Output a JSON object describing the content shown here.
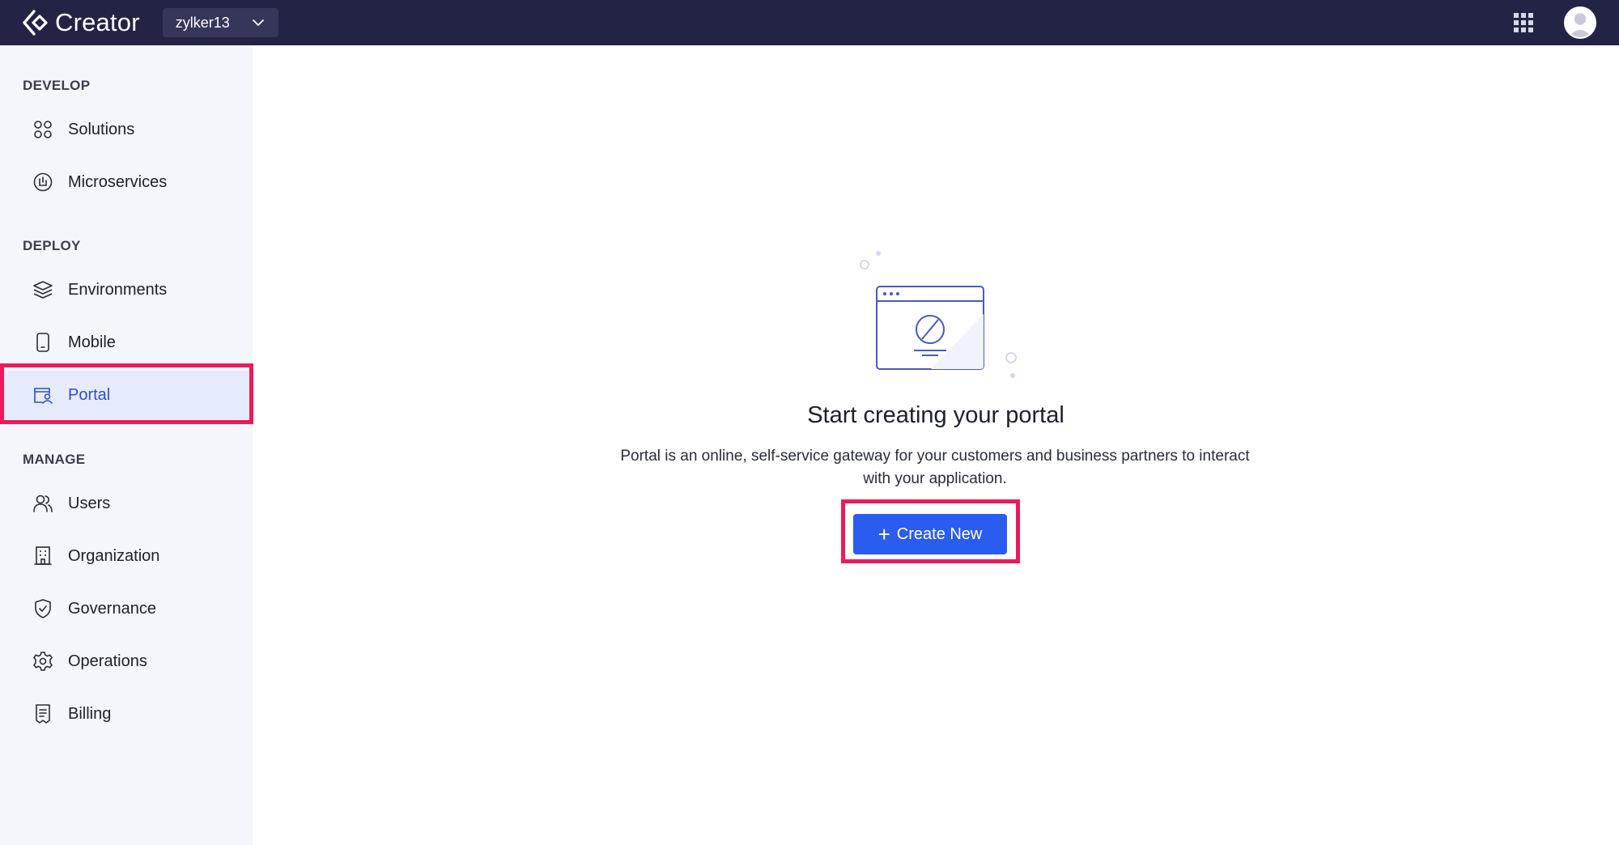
{
  "header": {
    "brand_name": "Creator",
    "workspace": "zylker13",
    "brand_icon": "creator-logo-icon",
    "apps_icon": "apps-grid-icon",
    "avatar_icon": "user-avatar-icon"
  },
  "sidebar": {
    "sections": [
      {
        "title": "DEVELOP",
        "items": [
          {
            "label": "Solutions",
            "icon": "solutions-icon"
          },
          {
            "label": "Microservices",
            "icon": "microservices-icon"
          }
        ]
      },
      {
        "title": "DEPLOY",
        "items": [
          {
            "label": "Environments",
            "icon": "layers-icon"
          },
          {
            "label": "Mobile",
            "icon": "mobile-icon"
          },
          {
            "label": "Portal",
            "icon": "portal-icon",
            "active": true
          }
        ]
      },
      {
        "title": "MANAGE",
        "items": [
          {
            "label": "Users",
            "icon": "users-icon"
          },
          {
            "label": "Organization",
            "icon": "building-icon"
          },
          {
            "label": "Governance",
            "icon": "shield-icon"
          },
          {
            "label": "Operations",
            "icon": "gear-icon"
          },
          {
            "label": "Billing",
            "icon": "receipt-icon"
          }
        ]
      }
    ]
  },
  "main": {
    "illustration_icon": "empty-portal-illustration",
    "heading": "Start creating your portal",
    "description": "Portal is an online, self-service gateway for your customers and business partners to interact with your application.",
    "create_button": {
      "label": "Create New",
      "icon": "plus-icon"
    }
  },
  "colors": {
    "topbar": "#232445",
    "sidebar": "#f5f6fb",
    "active_bg": "#e6ebfb",
    "accent": "#2a5cf0",
    "highlight": "#ec1a5b"
  }
}
